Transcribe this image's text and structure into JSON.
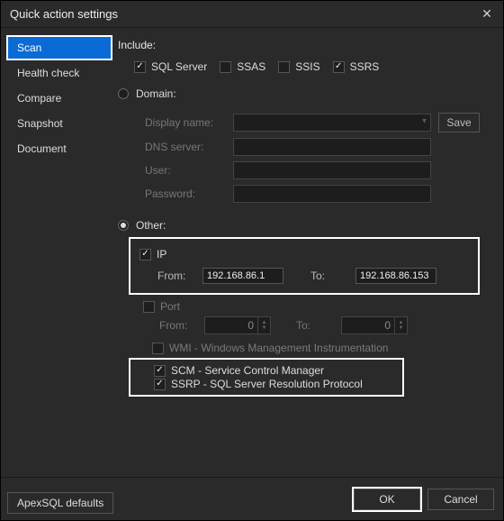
{
  "window": {
    "title": "Quick action settings"
  },
  "sidebar": {
    "items": [
      "Scan",
      "Health check",
      "Compare",
      "Snapshot",
      "Document"
    ]
  },
  "content": {
    "include_label": "Include:",
    "include_opts": {
      "sqlserver": "SQL Server",
      "ssas": "SSAS",
      "ssis": "SSIS",
      "ssrs": "SSRS"
    },
    "domain_label": "Domain:",
    "domain_fields": {
      "display_name": "Display name:",
      "dns": "DNS server:",
      "user": "User:",
      "password": "Password:"
    },
    "save_btn": "Save",
    "other_label": "Other:",
    "ip_label": "IP",
    "from_label": "From:",
    "to_label": "To:",
    "ip_from_value": "192.168.86.1",
    "ip_to_value": "192.168.86.153",
    "port_label": "Port",
    "port_from_value": "0",
    "port_to_value": "0",
    "wmi_label": "WMI - Windows Management Instrumentation",
    "scm_label": "SCM - Service Control Manager",
    "ssrp_label": "SSRP - SQL Server Resolution Protocol"
  },
  "footer": {
    "apex_defaults": "ApexSQL defaults",
    "ok": "OK",
    "cancel": "Cancel"
  }
}
